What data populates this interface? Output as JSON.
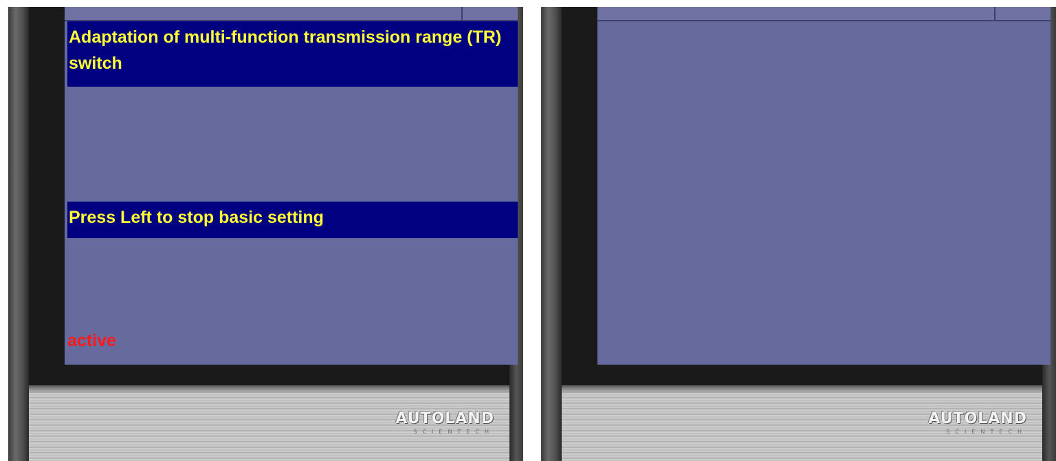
{
  "left_device": {
    "title": "Adaptation of multi-function transmission range (TR) switch",
    "message": "Press Left to stop basic setting",
    "status": "active",
    "logo": "AUTOLAND",
    "logo_sub": "SCIENTECH"
  },
  "right_device": {
    "logo": "AUTOLAND",
    "logo_sub": "SCIENTECH"
  },
  "colors": {
    "screen_bg": "#676a9c",
    "text_block_bg": "#000080",
    "text_block_fg": "#ffff33",
    "status_fg": "#ff1a1a"
  }
}
